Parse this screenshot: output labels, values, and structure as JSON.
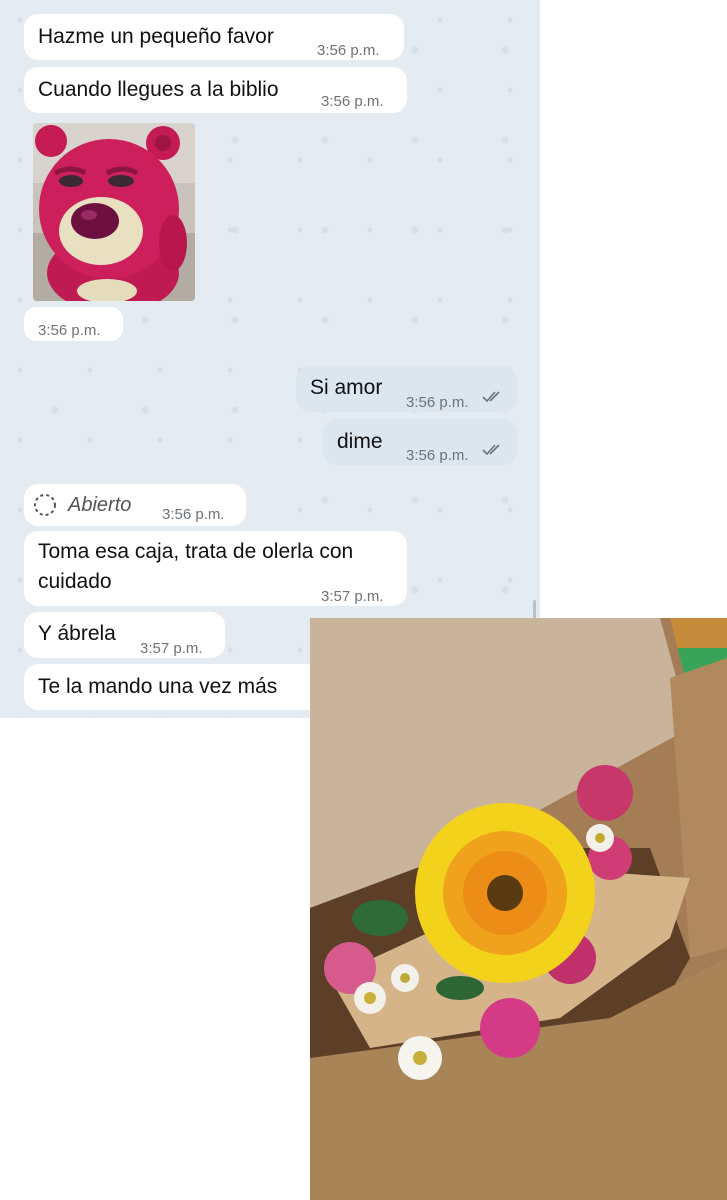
{
  "messages": [
    {
      "text": "Hazme un pequeño favor",
      "time": "3:56 p.m."
    },
    {
      "text": "Cuando llegues a la biblio",
      "time": "3:56 p.m."
    },
    {
      "sticker_time": "3:56 p.m."
    },
    {
      "text": "Si amor",
      "time": "3:56 p.m."
    },
    {
      "text": "dime",
      "time": "3:56 p.m."
    },
    {
      "text": "Abierto",
      "time": "3:56 p.m."
    },
    {
      "line1": "Toma esa caja, trata de olerla con",
      "line2": "cuidado",
      "time": "3:57 p.m."
    },
    {
      "text": "Y ábrela",
      "time": "3:57 p.m."
    },
    {
      "text": "Te la mando una vez más"
    }
  ],
  "icons": {
    "sticker": "lotso-bear-sticker",
    "read_receipt": "double-check-icon",
    "view_once": "view-once-opened-icon"
  },
  "colors": {
    "chat_background": "#e4ebf1",
    "incoming_bubble": "#ffffff",
    "outgoing_bubble": "#dce6ef",
    "timestamp": "#6e7378",
    "read_ticks": "#6e7378"
  }
}
